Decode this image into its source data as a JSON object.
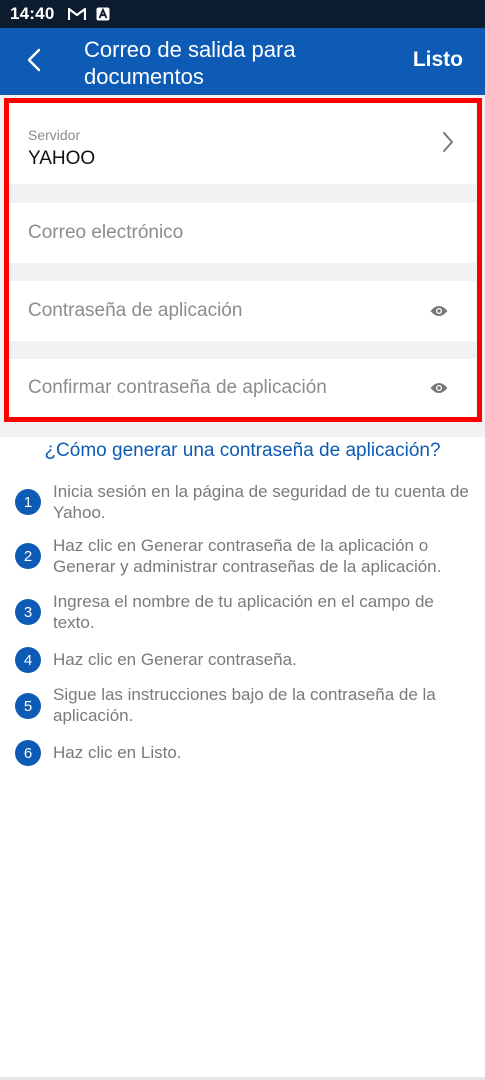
{
  "status_bar": {
    "time": "14:40",
    "icons": [
      "gmail-icon",
      "app-notification-icon"
    ]
  },
  "app_bar": {
    "back_icon": "chevron-left-icon",
    "title": "Correo de salida para documentos",
    "done_label": "Listo"
  },
  "form": {
    "server": {
      "label": "Servidor",
      "value": "YAHOO",
      "icon": "chevron-right-icon"
    },
    "email": {
      "placeholder": "Correo electrónico"
    },
    "password": {
      "placeholder": "Contraseña de aplicación",
      "icon": "eye-icon"
    },
    "confirm_password": {
      "placeholder": "Confirmar contraseña de aplicación",
      "icon": "eye-icon"
    }
  },
  "help": {
    "link": "¿Cómo generar una contraseña de aplicación?",
    "steps": [
      {
        "num": "1",
        "text": "Inicia sesión en la página de seguridad de tu cuenta de Yahoo."
      },
      {
        "num": "2",
        "text": "Haz clic en Generar contraseña de la aplicación o Generar y administrar contraseñas de la aplicación."
      },
      {
        "num": "3",
        "text": "Ingresa el nombre de tu aplicación en el campo de texto."
      },
      {
        "num": "4",
        "text": "Haz clic en Generar contraseña."
      },
      {
        "num": "5",
        "text": "Sigue las instrucciones bajo de la contraseña de la aplicación."
      },
      {
        "num": "6",
        "text": "Haz clic en Listo."
      }
    ]
  },
  "colors": {
    "app_bar": "#0d5bb5",
    "status_bar": "#0c1b2e",
    "highlight": "#ff0000",
    "link": "#0d5bb5"
  }
}
